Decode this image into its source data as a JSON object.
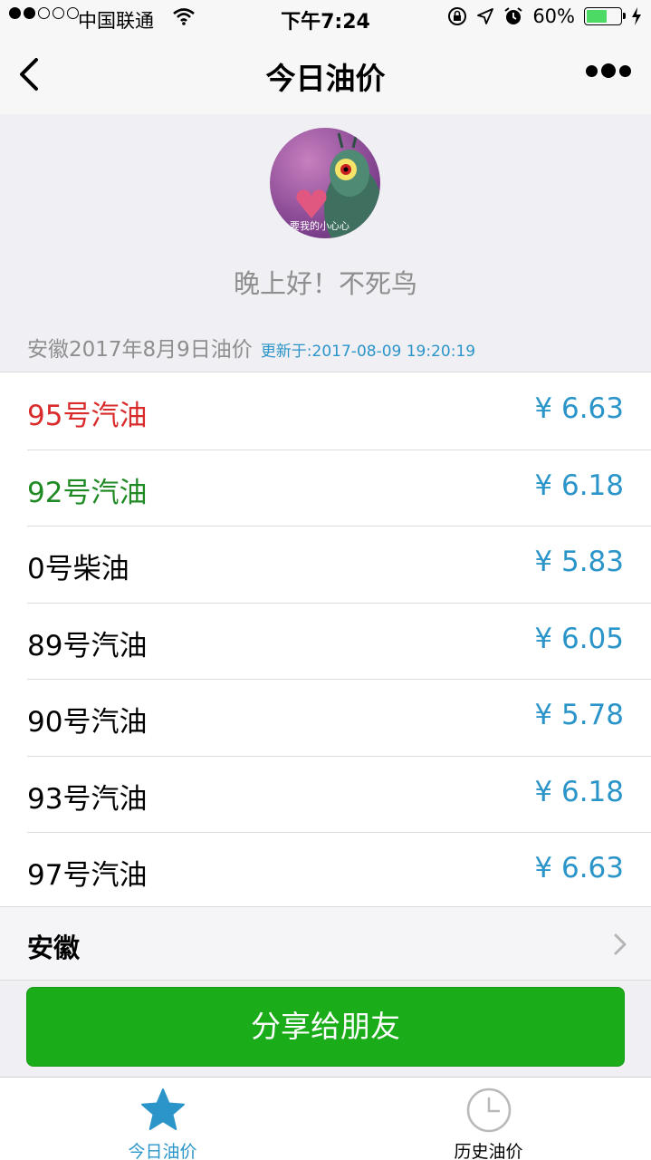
{
  "status_bar": {
    "carrier": "中国联通",
    "time": "下午7:24",
    "battery": "60%",
    "battery_level": 0.6
  },
  "nav": {
    "title": "今日油价"
  },
  "profile": {
    "avatar_caption": "要我的小心心",
    "greeting": "晚上好！不死鸟"
  },
  "section": {
    "title": "安徽2017年8月9日油价",
    "updated": "更新于:2017-08-09 19:20:19"
  },
  "prices": [
    {
      "name": "95号汽油",
      "value": "¥ 6.63",
      "color": "#d92b2b"
    },
    {
      "name": "92号汽油",
      "value": "¥ 6.18",
      "color": "#1f8a24"
    },
    {
      "name": "0号柴油",
      "value": "¥ 5.83",
      "color": "#000000"
    },
    {
      "name": "89号汽油",
      "value": "¥ 6.05",
      "color": "#000000"
    },
    {
      "name": "90号汽油",
      "value": "¥ 5.78",
      "color": "#000000"
    },
    {
      "name": "93号汽油",
      "value": "¥ 6.18",
      "color": "#000000"
    },
    {
      "name": "97号汽油",
      "value": "¥ 6.63",
      "color": "#000000"
    }
  ],
  "region": {
    "label": "安徽"
  },
  "share_button": "分享给朋友",
  "tabs": [
    {
      "label": "今日油价",
      "icon": "star-icon",
      "active": true
    },
    {
      "label": "历史油价",
      "icon": "clock-icon",
      "active": false
    }
  ],
  "colors": {
    "accent_blue": "#2b95c9",
    "button_green": "#1aad19"
  }
}
